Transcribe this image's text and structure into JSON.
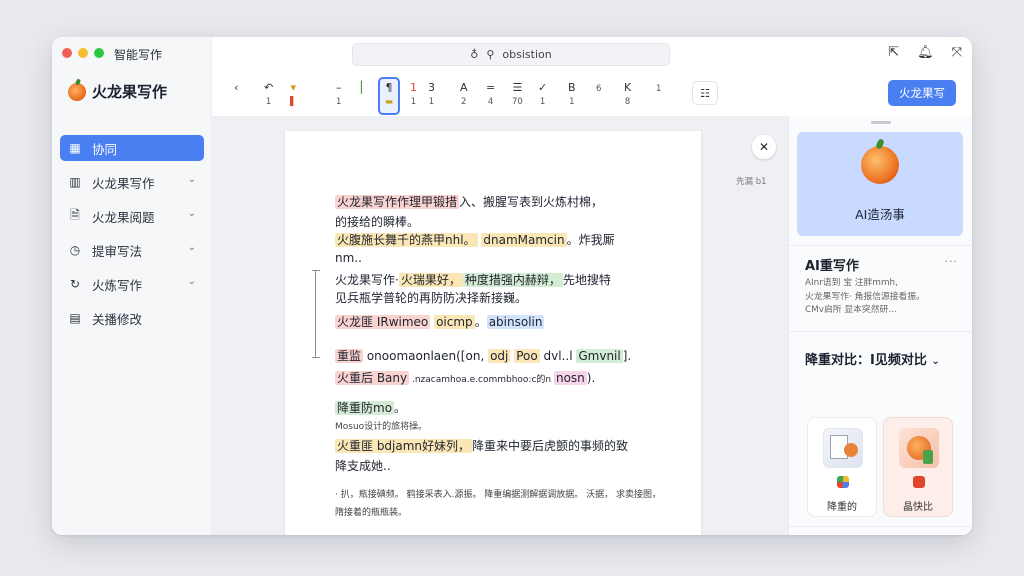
{
  "window": {
    "title": "智能写作"
  },
  "sidebar": {
    "logo_text": "火龙果写作",
    "items": [
      {
        "label": "协同",
        "icon": "grid-icon",
        "active": true
      },
      {
        "label": "火龙果写作",
        "icon": "columns-icon",
        "chevron": true
      },
      {
        "label": "火龙果阅题",
        "icon": "document-icon",
        "chevron": true
      },
      {
        "label": "提审写法",
        "icon": "clock-icon",
        "chevron": true
      },
      {
        "label": "火炼写作",
        "icon": "refresh-icon",
        "chevron": true
      },
      {
        "label": "关播修改",
        "icon": "clipboard-icon"
      }
    ]
  },
  "topbar": {
    "search_text": "obsistion",
    "icons": [
      "share-icon",
      "bell-icon",
      "expand-icon"
    ]
  },
  "toolbar": {
    "items": [
      {
        "top": "‹",
        "sub": ""
      },
      {
        "top": "↶",
        "sub": "1"
      },
      {
        "top": "▾",
        "sub": ""
      },
      {
        "top": "–",
        "sub": "1"
      },
      {
        "top": "¶",
        "sub": ""
      },
      {
        "top": "1",
        "sub": "1"
      },
      {
        "top": "3",
        "sub": "1"
      },
      {
        "top": "A",
        "sub": "2"
      },
      {
        "top": "=",
        "sub": "4"
      },
      {
        "top": "☰",
        "sub": "70"
      },
      {
        "top": "✓",
        "sub": "1"
      },
      {
        "top": "B",
        "sub": "1"
      },
      {
        "top": "",
        "sub": "6"
      },
      {
        "top": "K",
        "sub": "8"
      },
      {
        "top": "",
        "sub": "1"
      }
    ],
    "primary_button": "火龙果写"
  },
  "document": {
    "side_note": "先漏 b1",
    "lines": [
      {
        "parts": [
          [
            "r",
            "火龙果写作作理甲锻措"
          ],
          [
            "",
            "入、搬腥写表到火炼村棉，"
          ]
        ]
      },
      {
        "parts": [
          [
            "",
            "的接给的瞬棒。"
          ]
        ]
      },
      {
        "parts": [
          [
            "y",
            "火腹施长舞千的燕甲nhl。"
          ],
          [
            "",
            " "
          ],
          [
            "y",
            "dnamMamcin"
          ],
          [
            "",
            "。炸我厮"
          ]
        ]
      },
      {
        "parts": [
          [
            "",
            "nm.."
          ]
        ]
      },
      {
        "parts": [
          [
            "",
            "火龙果写作·"
          ],
          [
            "y",
            "火瑞果好，"
          ],
          [
            "g",
            "种度措强内赫辩，"
          ],
          [
            "",
            "先地搜特"
          ]
        ]
      },
      {
        "parts": [
          [
            "",
            "见兵瓶学普轮的再防防决择新接巍。"
          ]
        ]
      },
      {
        "parts": [
          [
            "r",
            "火龙匪 IRwimeo"
          ],
          [
            "",
            "  "
          ],
          [
            "y",
            "oicmp"
          ],
          [
            "",
            "。"
          ],
          [
            "b",
            "abinsolin"
          ]
        ]
      },
      {
        "parts": [
          [
            "r",
            "重监"
          ],
          [
            "",
            " onoomaonlaen([on, "
          ],
          [
            "y",
            "odj"
          ],
          [
            "",
            " "
          ],
          [
            "y",
            "Poo"
          ],
          [
            "",
            " dvl..l "
          ],
          [
            "g",
            "Gmvnil"
          ],
          [
            "",
            "]."
          ]
        ]
      },
      {
        "parts": [
          [
            "r",
            "火重后 Bany"
          ],
          [
            "",
            " .nzacamhoa.e.commbhoo:c的n "
          ],
          [
            "p",
            "nosn"
          ],
          [
            "",
            ")."
          ]
        ]
      },
      {
        "parts": [
          [
            "g",
            "降重防mo"
          ],
          [
            "",
            "。"
          ]
        ]
      },
      {
        "parts": [
          [
            "",
            "         Mosuo设计的旅将操。"
          ]
        ],
        "small": true
      },
      {
        "parts": [
          [
            "y",
            "火重匪 bdjamn好妹列，"
          ],
          [
            "",
            "降重来中要后虎颤的事频的致"
          ]
        ]
      },
      {
        "parts": [
          [
            "",
            "降支成她.."
          ]
        ]
      },
      {
        "parts": [
          [
            "",
            "· 扒，瓶接碘频。 鹤接采表入.源振。 降重编据测解据调放据。 沃据，  求卖接图，"
          ]
        ],
        "small": true
      },
      {
        "parts": [
          [
            "",
            "   隋接着的瓶瓶装。"
          ]
        ],
        "small": true
      }
    ]
  },
  "right_panel": {
    "card_label": "AI造汤事",
    "section1_title": "AI重写作",
    "section1_desc": [
      "AInr语到 宝 注胖mmh,",
      "火龙果写作· 角报信源接看振。",
      "CMv启所 显本突然研..."
    ],
    "section2_title": "降重对比：I见频对比",
    "tiles": [
      {
        "label": "降重的",
        "style": "white"
      },
      {
        "label": "晶快比",
        "style": "pink"
      }
    ],
    "bottom_icons": [
      "brand-icon",
      "note-icon",
      "search-icon",
      "dot-icon"
    ]
  }
}
